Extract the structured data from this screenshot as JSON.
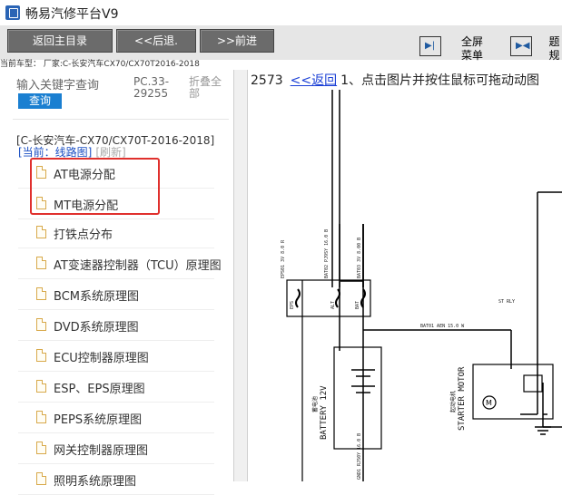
{
  "app": {
    "title": "畅易汽修平台V9"
  },
  "toolbar": {
    "home": "返回主目录",
    "back": "<<后退.",
    "forward": ">>前进",
    "fullscreen_line1": "全屏",
    "fullscreen_line2": "菜单",
    "extra_line1": "题",
    "extra_line2": "规"
  },
  "vehicle_bar": "当前车型： 厂家:C-长安汽车CX70/CX70T2016-2018",
  "search": {
    "placeholder": "输入关键字查询",
    "button": "查询"
  },
  "pc_code": "PC.33-29255",
  "fold_all": "折叠全部",
  "tree": {
    "title": "[C-长安汽车-CX70/CX70T-2016-2018]",
    "current": "[当前：线路图]",
    "refresh": "[刷新]",
    "items": [
      {
        "label": "AT电源分配"
      },
      {
        "label": "MT电源分配"
      },
      {
        "label": "打铁点分布"
      },
      {
        "label": "AT变速器控制器（TCU）原理图"
      },
      {
        "label": "BCM系统原理图"
      },
      {
        "label": "DVD系统原理图"
      },
      {
        "label": "ECU控制器原理图"
      },
      {
        "label": "ESP、EPS原理图"
      },
      {
        "label": "PEPS系统原理图"
      },
      {
        "label": "网关控制器原理图"
      },
      {
        "label": "照明系统原理图"
      }
    ]
  },
  "diagram": {
    "page_no": "2573",
    "back_link": "<<返回",
    "instruction": "1、点击图片并按住鼠标可拖动动图",
    "wire_labels": [
      "EPS01 3V 8.0 R",
      "BAT02 PJ9SY 16.0 B",
      "BAT03 3V 8.00 B",
      "BAT01 AEN 15.0 W",
      "ST RLY",
      "GND1 RJ50Y 16.0 B"
    ],
    "fuse_labels": [
      "EPS",
      "ALT",
      "BAT"
    ],
    "battery_label": "BATTERY 12V",
    "battery_cn": "蓄电池",
    "battery_voltage": "12V",
    "starter_label": "STARTER MOTOR",
    "starter_cn": "起动电机"
  }
}
